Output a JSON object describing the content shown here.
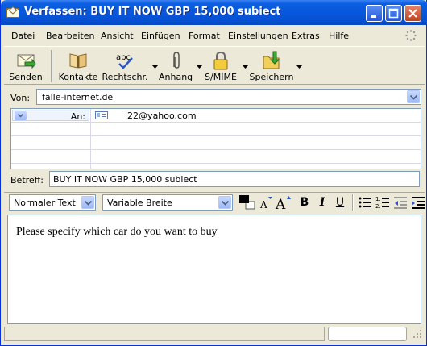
{
  "window": {
    "title": "Verfassen: BUY IT NOW GBP 15,000 subiect"
  },
  "menu": {
    "items": [
      "Datei",
      "Bearbeiten",
      "Ansicht",
      "Einfügen",
      "Format",
      "Einstellungen",
      "Extras",
      "Hilfe"
    ]
  },
  "toolbar": {
    "send": "Senden",
    "contacts": "Kontakte",
    "spell": "Rechtschr.",
    "attach": "Anhang",
    "smime": "S/MIME",
    "save": "Speichern"
  },
  "header": {
    "from_label": "Von:",
    "from_value": "falle-internet.de",
    "to_label": "An:",
    "to_value": "i22@yahoo.com",
    "subject_label": "Betreff:",
    "subject_value": "BUY IT NOW GBP 15,000 subiect"
  },
  "format": {
    "paragraph_style": "Normaler Text",
    "font": "Variable Breite",
    "bold": "B",
    "italic": "I",
    "underline": "U"
  },
  "editor": {
    "body": "Please specify which car do you want to buy"
  },
  "colors": {
    "titlebar": "#0857dc",
    "chrome": "#ece9d8",
    "field_border": "#7f9db9"
  },
  "icons": [
    "envelope-icon",
    "send-icon",
    "contacts-icon",
    "spellcheck-icon",
    "paperclip-icon",
    "lock-icon",
    "save-icon",
    "minimize-icon",
    "maximize-icon",
    "close-icon"
  ]
}
